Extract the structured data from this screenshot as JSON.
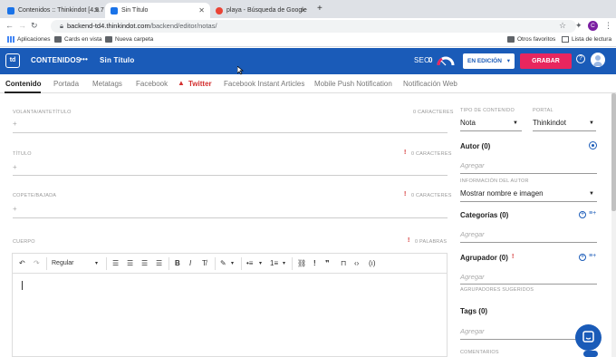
{
  "browser": {
    "tabs": [
      {
        "title": "Contenidos :: Thinkindot [4.5.7",
        "active": false,
        "favicon_color": "#1a73e8"
      },
      {
        "title": "Sin Título",
        "active": true,
        "favicon_color": "#1a73e8"
      },
      {
        "title": "playa - Búsqueda de Google",
        "active": false,
        "favicon_color": "#ea4335"
      }
    ],
    "new_tab": "+",
    "url_host": "backend-td4.thinkindot.com",
    "url_path": "/backend/editor/notas/",
    "avatar_letter": "C",
    "bookmarks": [
      {
        "label": "Aplicaciones",
        "icon": "apps-grid-icon"
      },
      {
        "label": "Cards en vista",
        "icon": "folder-icon"
      },
      {
        "label": "Nueva carpeta",
        "icon": "folder-icon"
      }
    ],
    "other_favorites": "Otros favoritos",
    "reading_list": "Lista de lectura"
  },
  "header": {
    "logo": "td",
    "section": "CONTENIDOS",
    "more": "•••",
    "doc_title": "Sin Título",
    "seo_label": "SEO",
    "seo_value": "0",
    "status": "EN EDICIÓN",
    "save": "GRABAR",
    "help": "?"
  },
  "tabs": [
    {
      "label": "Contenido",
      "state": "active"
    },
    {
      "label": "Portada",
      "state": ""
    },
    {
      "label": "Metatags",
      "state": ""
    },
    {
      "label": "Facebook",
      "state": ""
    },
    {
      "label": "Twitter",
      "state": "warn"
    },
    {
      "label": "Facebook Instant Articles",
      "state": ""
    },
    {
      "label": "Mobile Push Notification",
      "state": ""
    },
    {
      "label": "Notificación Web",
      "state": ""
    }
  ],
  "form": {
    "volanta_label": "VOLANTA/ANTETÍTULO",
    "volanta_count": "0 CARACTERES",
    "titulo_label": "TÍTULO",
    "titulo_count": "0 CARACTERES",
    "copete_label": "COPETE/BAJADA",
    "copete_count": "0 CARACTERES",
    "cuerpo_label": "CUERPO",
    "cuerpo_count": "0 PALABRAS",
    "plus": "+",
    "required": "!"
  },
  "editor": {
    "format_select": "Regular"
  },
  "sidebar": {
    "tipo_label": "TIPO DE CONTENIDO",
    "tipo_value": "Nota",
    "portal_label": "PORTAL",
    "portal_value": "Thinkindot",
    "autor_title": "Autor (0)",
    "autor_placeholder": "Agregar",
    "info_label": "INFORMACIÓN DEL AUTOR",
    "info_value": "Mostrar nombre e imagen",
    "categorias_title": "Categorías (0)",
    "categorias_placeholder": "Agregar",
    "agrupador_title": "Agrupador (0)",
    "agrupador_placeholder": "Agregar",
    "agrupadores_sugeridos": "AGRUPADORES SUGERIDOS",
    "tags_title": "Tags (0)",
    "tags_placeholder": "Agregar",
    "comentarios_label": "COMENTARIOS"
  },
  "colors": {
    "brand": "#1a5bb8",
    "save": "#e8265e",
    "warn": "#d32f2f"
  }
}
